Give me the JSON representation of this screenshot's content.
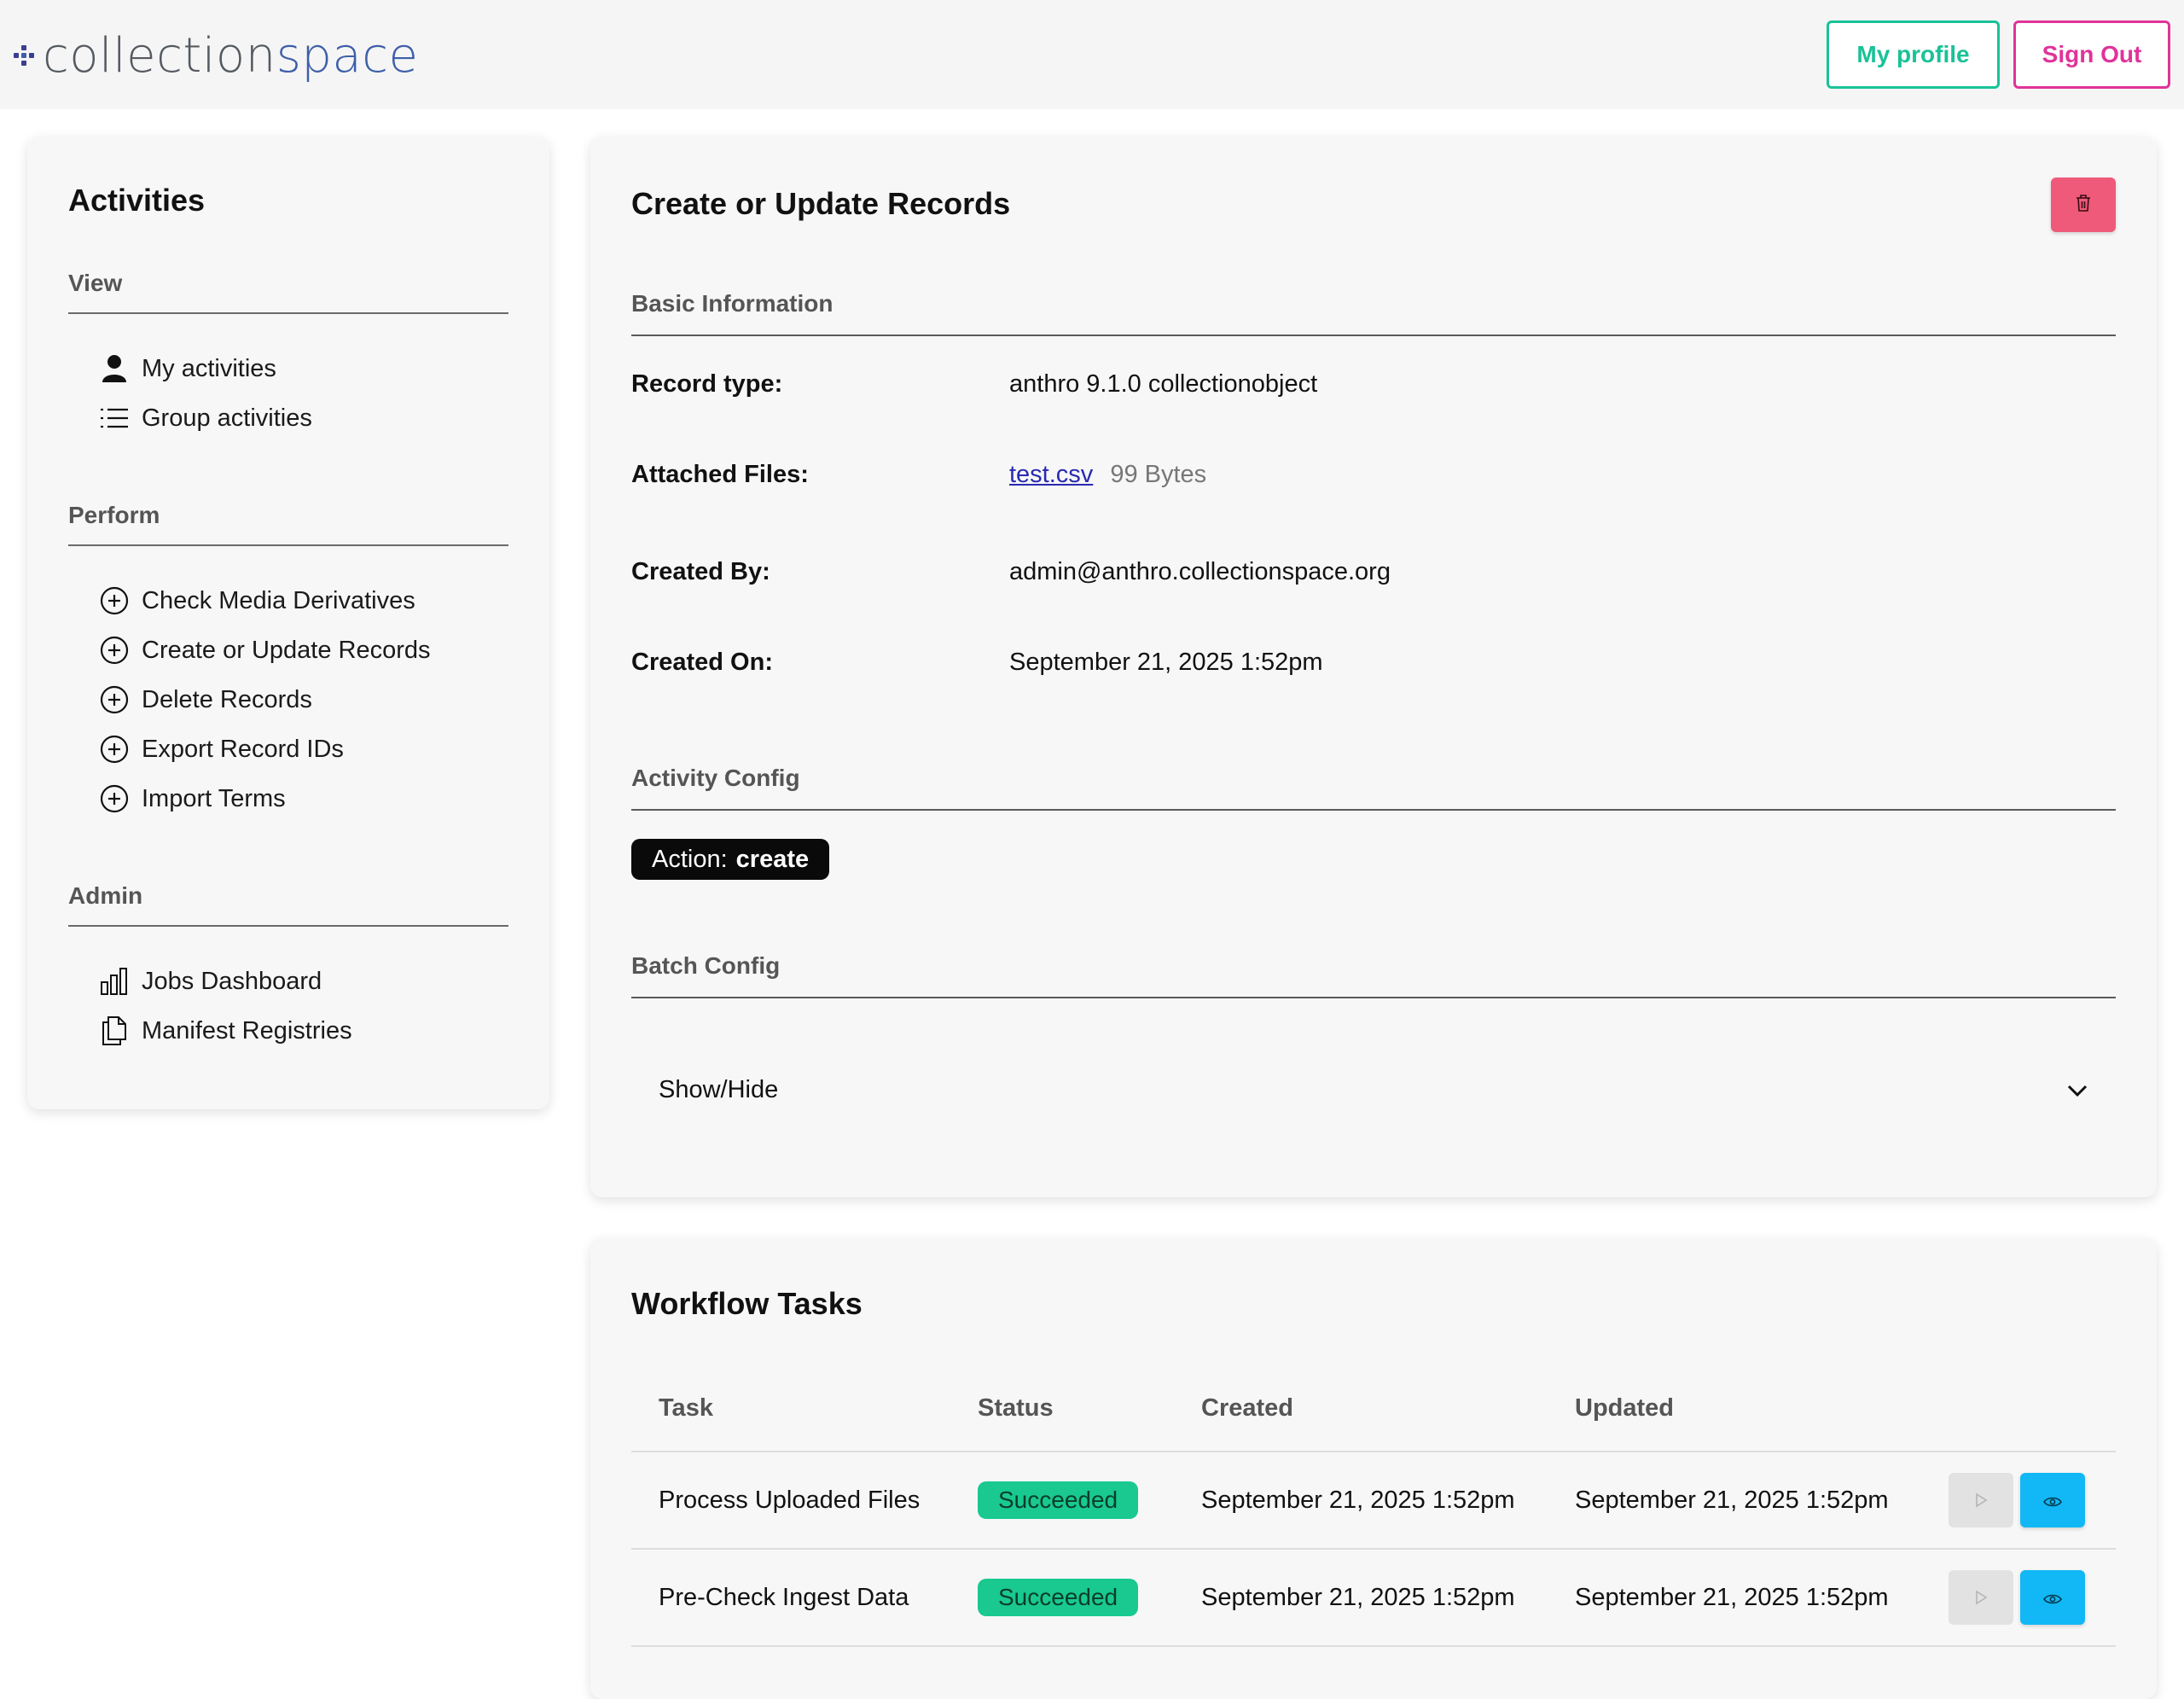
{
  "header": {
    "logo_part1": "collection",
    "logo_part2": "space",
    "my_profile_label": "My profile",
    "sign_out_label": "Sign Out"
  },
  "sidebar": {
    "title": "Activities",
    "sections": {
      "view": {
        "label": "View",
        "items": [
          {
            "label": "My activities",
            "icon": "person-icon"
          },
          {
            "label": "Group activities",
            "icon": "list-icon"
          }
        ]
      },
      "perform": {
        "label": "Perform",
        "items": [
          {
            "label": "Check Media Derivatives",
            "icon": "plus-circle-icon"
          },
          {
            "label": "Create or Update Records",
            "icon": "plus-circle-icon"
          },
          {
            "label": "Delete Records",
            "icon": "plus-circle-icon"
          },
          {
            "label": "Export Record IDs",
            "icon": "plus-circle-icon"
          },
          {
            "label": "Import Terms",
            "icon": "plus-circle-icon"
          }
        ]
      },
      "admin": {
        "label": "Admin",
        "items": [
          {
            "label": "Jobs Dashboard",
            "icon": "bar-chart-icon"
          },
          {
            "label": "Manifest Registries",
            "icon": "documents-icon"
          }
        ]
      }
    }
  },
  "main": {
    "title": "Create or Update Records",
    "basic_info_label": "Basic Information",
    "fields": {
      "record_type": {
        "label": "Record type:",
        "value": "anthro 9.1.0 collectionobject"
      },
      "attached_files": {
        "label": "Attached Files:",
        "file_name": "test.csv",
        "file_size": "99 Bytes"
      },
      "created_by": {
        "label": "Created By:",
        "value": "admin@anthro.collectionspace.org"
      },
      "created_on": {
        "label": "Created On:",
        "value": "September 21, 2025 1:52pm"
      }
    },
    "activity_config_label": "Activity Config",
    "action_key": "Action:",
    "action_value": "create",
    "batch_config_label": "Batch Config",
    "show_hide_label": "Show/Hide"
  },
  "workflow": {
    "title": "Workflow Tasks",
    "columns": [
      "Task",
      "Status",
      "Created",
      "Updated"
    ],
    "rows": [
      {
        "task": "Process Uploaded Files",
        "status": "Succeeded",
        "created": "September 21, 2025 1:52pm",
        "updated": "September 21, 2025 1:52pm"
      },
      {
        "task": "Pre-Check Ingest Data",
        "status": "Succeeded",
        "created": "September 21, 2025 1:52pm",
        "updated": "September 21, 2025 1:52pm"
      }
    ]
  },
  "colors": {
    "profile_accent": "#19c297",
    "signout_accent": "#e0339a",
    "delete_button": "#ef5a7a",
    "status_success": "#19c98f",
    "view_button": "#12b8f5"
  }
}
